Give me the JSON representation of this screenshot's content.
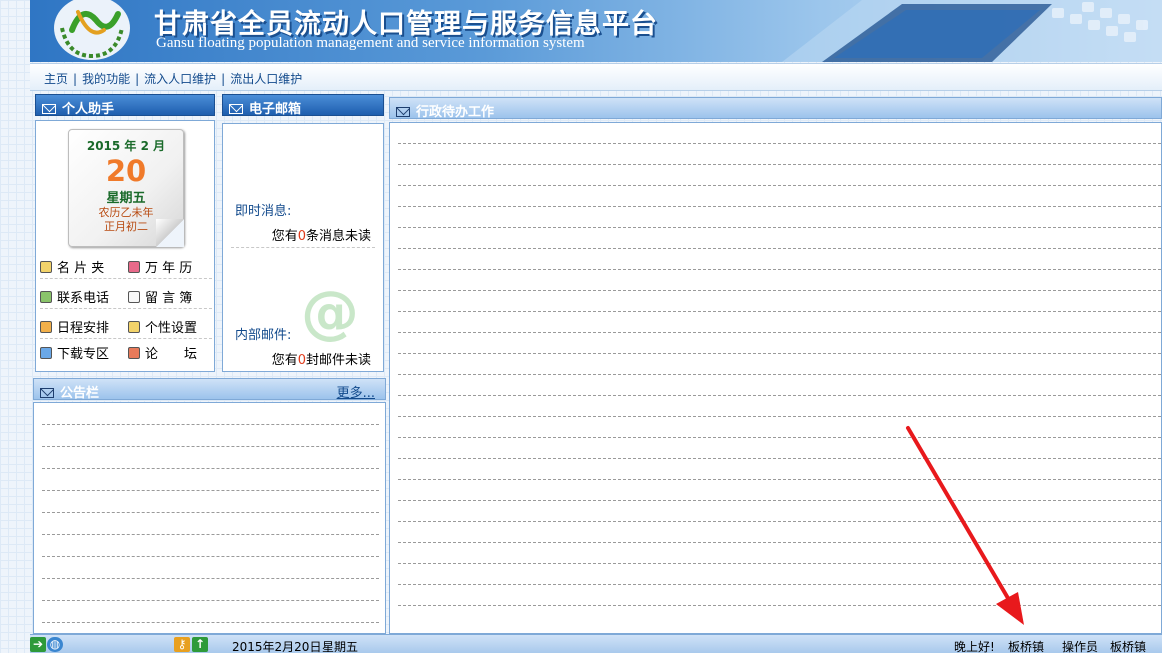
{
  "header": {
    "title_cn": "甘肃省全员流动人口管理与服务信息平台",
    "title_en": "Gansu floating population management and service information system"
  },
  "nav": {
    "items": [
      {
        "label": "主页"
      },
      {
        "label": "我的功能"
      },
      {
        "label": "流入人口维护"
      },
      {
        "label": "流出人口维护"
      }
    ],
    "separator": "|"
  },
  "assistant": {
    "title": "个人助手",
    "calendar": {
      "year_month": "2015 年 2 月",
      "day": "20",
      "weekday": "星期五",
      "lunar_year": "农历乙未年",
      "lunar_day": "正月初二"
    },
    "tools": [
      {
        "label": "名 片 夹"
      },
      {
        "label": "万 年 历"
      },
      {
        "label": "联系电话"
      },
      {
        "label": "留 言 簿"
      },
      {
        "label": "日程安排"
      },
      {
        "label": "个性设置"
      },
      {
        "label": "下载专区"
      },
      {
        "label": "论　　坛"
      }
    ]
  },
  "mailbox": {
    "title": "电子邮箱",
    "instant_label": "即时消息:",
    "instant_prefix": "您有",
    "instant_count": "0",
    "instant_suffix": "条消息未读",
    "internal_label": "内部邮件:",
    "internal_prefix": "您有",
    "internal_count": "0",
    "internal_suffix": "封邮件未读"
  },
  "bulletin": {
    "title": "公告栏",
    "more": "更多..."
  },
  "admin": {
    "title": "行政待办工作"
  },
  "statusbar": {
    "date": "2015年2月20日",
    "weekday": "星期五",
    "greeting": "晚上好!",
    "town": "板桥镇",
    "role": "操作员",
    "user": "板桥镇"
  },
  "colors": {
    "header_blue": "#1e5eae",
    "link_blue": "#124a8c",
    "unread_red": "#e03a1a",
    "arrow_red": "#e8191c"
  }
}
